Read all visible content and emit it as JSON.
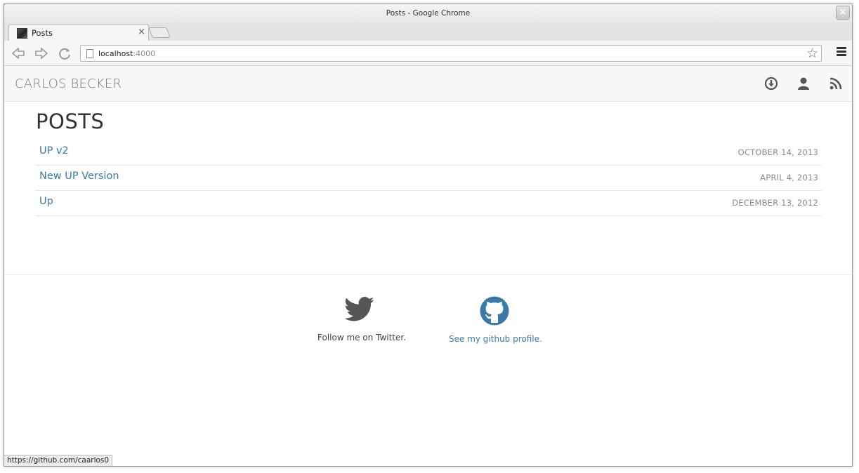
{
  "window": {
    "title": "Posts - Google Chrome",
    "close_label": "×"
  },
  "tab": {
    "title": "Posts",
    "close_label": "×"
  },
  "toolbar": {
    "back_icon": "back-arrow-icon",
    "forward_icon": "forward-arrow-icon",
    "reload_icon": "reload-icon",
    "url_host": "localhost",
    "url_port": ":4000"
  },
  "site": {
    "brand": "CARLOS BECKER",
    "header_icons": [
      "download-icon",
      "user-icon",
      "rss-icon"
    ],
    "heading": "POSTS"
  },
  "posts": [
    {
      "title": "UP v2",
      "date": "OCTOBER 14, 2013"
    },
    {
      "title": "New UP Version",
      "date": "APRIL 4, 2013"
    },
    {
      "title": "Up",
      "date": "DECEMBER 13, 2012"
    }
  ],
  "footer": {
    "twitter_label": "Follow me on Twitter.",
    "github_label": "See my github profile."
  },
  "statusbar": {
    "url": "https://github.com/caarlos0"
  },
  "colors": {
    "link": "#3a7aa8",
    "brand": "#777777",
    "icon": "#555555"
  }
}
